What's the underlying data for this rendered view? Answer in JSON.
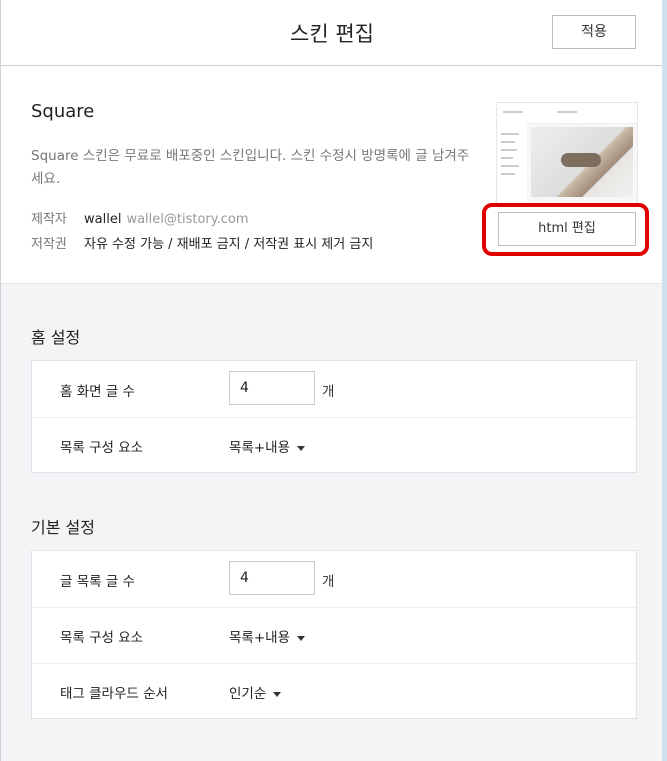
{
  "header": {
    "title": "스킨 편집",
    "apply_label": "적용"
  },
  "skin": {
    "name": "Square",
    "description": "Square 스킨은 무료로 배포중인 스킨입니다. 스킨 수정시 방명록에 글 남겨주세요.",
    "author_label": "제작자",
    "author_name": "wallel",
    "author_email": "wallel@tistory.com",
    "license_label": "저작권",
    "license_text": "자유 수정 가능 / 재배포 금지 / 저작권 표시 제거 금지",
    "html_edit_label": "html 편집"
  },
  "home_settings": {
    "title": "홈 설정",
    "post_count_label": "홈 화면 글 수",
    "post_count_value": "4",
    "unit": "개",
    "list_components_label": "목록 구성 요소",
    "list_components_value": "목록+내용"
  },
  "basic_settings": {
    "title": "기본 설정",
    "list_count_label": "글 목록 글 수",
    "list_count_value": "4",
    "unit": "개",
    "list_components_label": "목록 구성 요소",
    "list_components_value": "목록+내용",
    "tag_cloud_label": "태그 클라우드 순서",
    "tag_cloud_value": "인기순"
  },
  "colors": {
    "highlight": "#e00000",
    "rail": "#cfe0f1"
  }
}
